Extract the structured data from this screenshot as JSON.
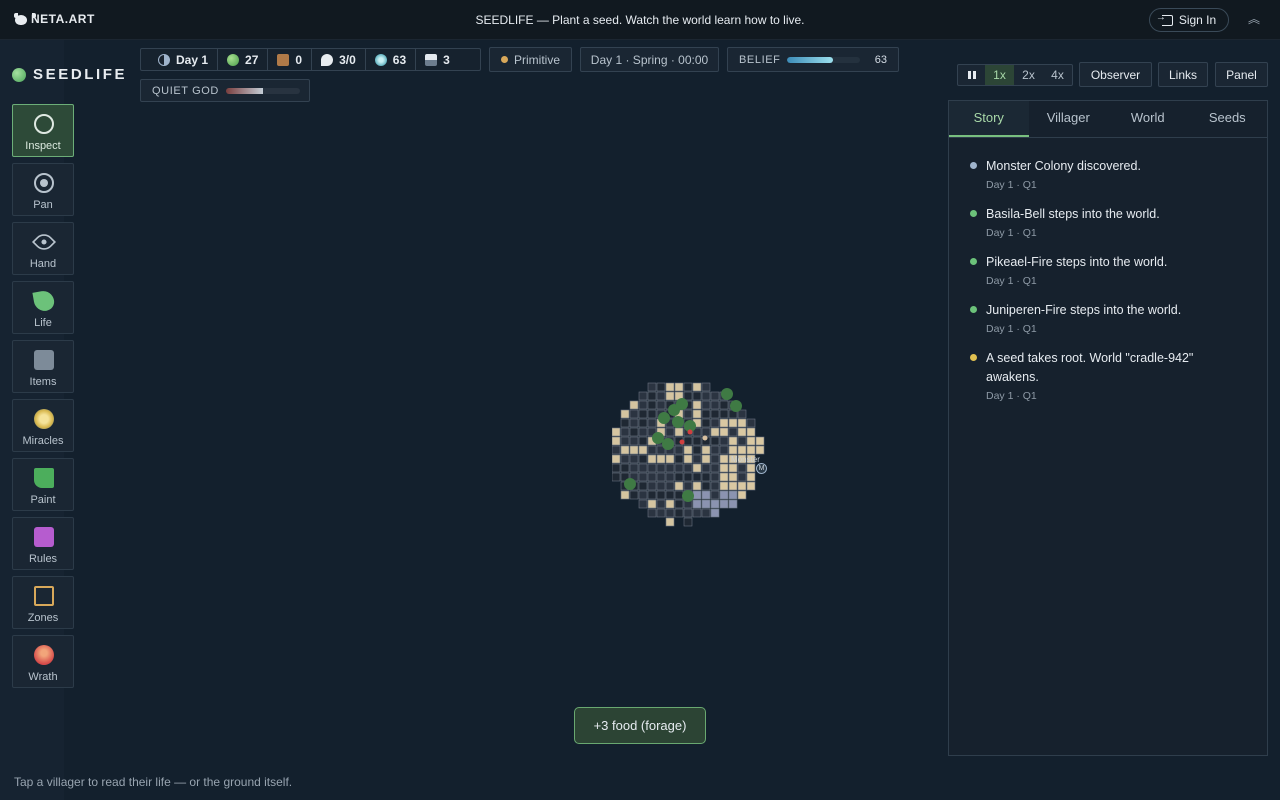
{
  "topbar": {
    "brand": "NETA.ART",
    "headline": "SEEDLIFE — Plant a seed. Watch the world learn how to live.",
    "signin_label": "Sign In"
  },
  "logo": {
    "title": "SEEDLIFE"
  },
  "tools": [
    {
      "id": "inspect",
      "label": "Inspect",
      "icon": "circle-ring-icon",
      "active": true
    },
    {
      "id": "pan",
      "label": "Pan",
      "icon": "target-icon"
    },
    {
      "id": "hand",
      "label": "Hand",
      "icon": "eye-icon"
    },
    {
      "id": "life",
      "label": "Life",
      "icon": "leaf-icon"
    },
    {
      "id": "items",
      "label": "Items",
      "icon": "box-icon"
    },
    {
      "id": "miracles",
      "label": "Miracles",
      "icon": "sun-icon"
    },
    {
      "id": "paint",
      "label": "Paint",
      "icon": "paint-icon"
    },
    {
      "id": "rules",
      "label": "Rules",
      "icon": "rules-icon"
    },
    {
      "id": "zones",
      "label": "Zones",
      "icon": "zones-icon"
    },
    {
      "id": "wrath",
      "label": "Wrath",
      "icon": "wrath-icon"
    }
  ],
  "stats": {
    "day": "Day 1",
    "population": "27",
    "food": "0",
    "housing": "3/0",
    "faith": "63",
    "stone": "3"
  },
  "era": "Primitive",
  "clock": "Day 1 · Spring · 00:00",
  "belief": {
    "label": "BELIEF",
    "value": "63",
    "level": 0.63
  },
  "quiet_god": {
    "label": "QUIET GOD",
    "level": 0.5
  },
  "speed": {
    "options": [
      "1x",
      "2x",
      "4x"
    ],
    "selected": "1x"
  },
  "buttons": {
    "observer": "Observer",
    "links": "Links",
    "panel": "Panel"
  },
  "panel": {
    "tabs": [
      "Story",
      "Villager",
      "World",
      "Seeds"
    ],
    "active_tab": "Story",
    "entries": [
      {
        "text": "Monster Colony discovered.",
        "meta": "Day 1 · Q1",
        "color": "#9fb4cc"
      },
      {
        "text": "Basila-Bell steps into the world.",
        "meta": "Day 1 · Q1",
        "color": "#6cc27a"
      },
      {
        "text": "Pikeael-Fire steps into the world.",
        "meta": "Day 1 · Q1",
        "color": "#6cc27a"
      },
      {
        "text": "Juniperen-Fire steps into the world.",
        "meta": "Day 1 · Q1",
        "color": "#6cc27a"
      },
      {
        "text": "A seed takes root. World \"cradle-942\" awakens.",
        "meta": "Day 1 · Q1",
        "color": "#e0c050"
      }
    ]
  },
  "map": {
    "monster_label": "Monster",
    "monster_marker": "M"
  },
  "toast": "+3 food (forage)",
  "hint": "Tap a villager to read their life — or the ground itself."
}
